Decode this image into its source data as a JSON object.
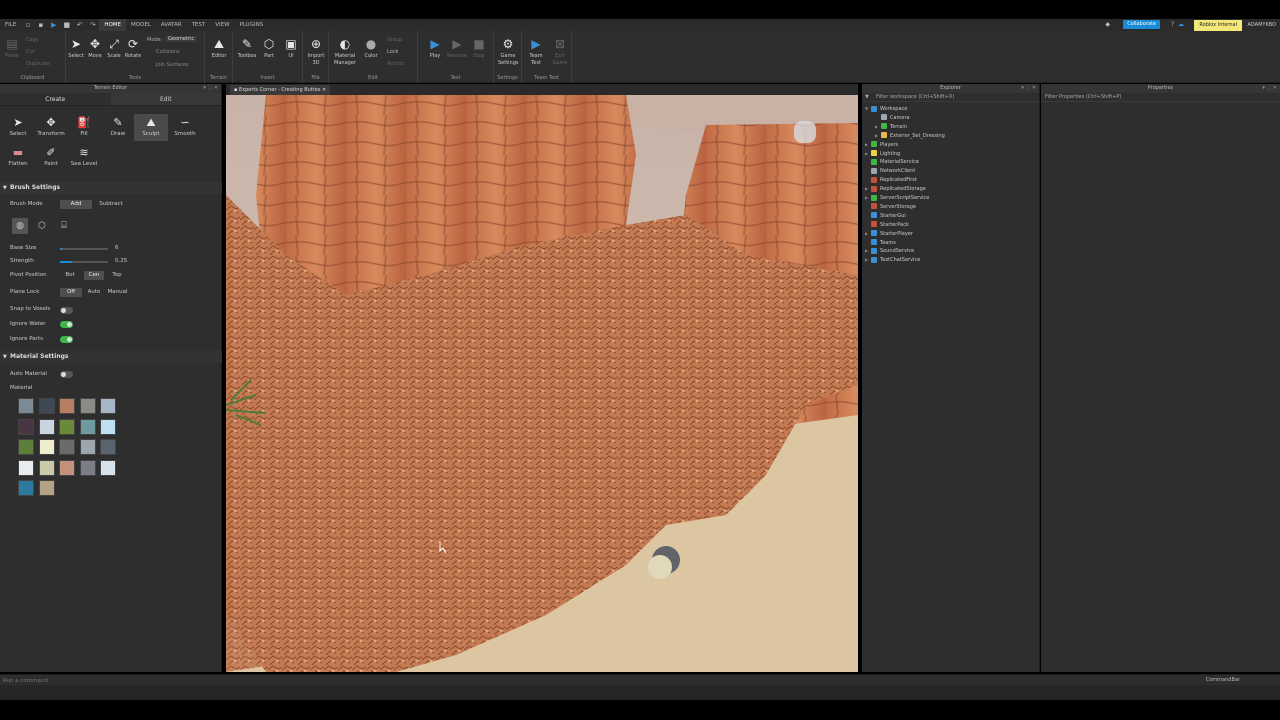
{
  "menu": {
    "file": "FILE",
    "tabs": [
      "HOME",
      "MODEL",
      "AVATAR",
      "TEST",
      "VIEW",
      "PLUGINS"
    ],
    "collaborate": "Collaborate",
    "internal": "Roblox Internal",
    "user": "ADAMYKBO"
  },
  "ribbon": {
    "clipboard": {
      "label": "Clipboard",
      "paste": "Paste",
      "copy": "Copy",
      "cut": "Cut",
      "duplicate": "Duplicate"
    },
    "tools": {
      "label": "Tools",
      "select": "Select",
      "move": "Move",
      "scale": "Scale",
      "rotate": "Rotate",
      "mode_label": "Mode:",
      "mode_value": "Geometric",
      "collisions": "Collisions",
      "join": "Join Surfaces"
    },
    "terrain": {
      "label": "Terrain",
      "editor": "Editor"
    },
    "insert": {
      "label": "Insert",
      "toolbox": "Toolbox",
      "part": "Part",
      "ui": "UI"
    },
    "file": {
      "label": "File",
      "import": "Import 3D"
    },
    "edit": {
      "label": "Edit",
      "material": "Material Manager",
      "color": "Color",
      "group": "Group",
      "lock": "Lock",
      "anchor": "Anchor"
    },
    "test": {
      "label": "Test",
      "play": "Play",
      "resume": "Resume",
      "stop": "Stop"
    },
    "settings": {
      "label": "Settings",
      "game": "Game Settings"
    },
    "team": {
      "label": "Team Test",
      "teamtest": "Team Test",
      "exit": "Exit Game"
    }
  },
  "terrain_editor": {
    "title": "Terrain Editor",
    "tab_create": "Create",
    "tab_edit": "Edit",
    "tools": [
      "Select",
      "Transform",
      "Fill",
      "Draw",
      "Sculpt",
      "Smooth",
      "Flatten",
      "Paint",
      "Sea Level"
    ],
    "brush_settings": "Brush Settings",
    "brush_mode": "Brush Mode",
    "add": "Add",
    "subtract": "Subtract",
    "base_size": "Base Size",
    "base_size_value": "6",
    "base_size_frac": 0.05,
    "strength": "Strength",
    "strength_value": "0.25",
    "strength_frac": 0.25,
    "pivot": "Pivot Position",
    "pivot_opts": [
      "Bot",
      "Cen",
      "Top"
    ],
    "plane_lock": "Plane Lock",
    "plane_opts": [
      "Off",
      "Auto",
      "Manual"
    ],
    "snap": "Snap to Voxels",
    "ignore_water": "Ignore Water",
    "ignore_parts": "Ignore Parts",
    "material_settings": "Material Settings",
    "auto_material": "Auto Material",
    "material": "Material",
    "swatches": [
      "#7c8a96",
      "#3f4855",
      "#b67f64",
      "#8a8a86",
      "#a6b6c7",
      "#4a3544",
      "#c9d4e0",
      "#6a8a3a",
      "#6e9aa0",
      "#bfe0f2",
      "#5d7f3a",
      "#eeeccf",
      "#6b6b6b",
      "#9ea7ae",
      "#596470",
      "#e9ecef",
      "#c8c9a6",
      "#c4927a",
      "#7a7e86",
      "#d6e2ec",
      "#2a7b9e",
      "#b3a488"
    ]
  },
  "viewport": {
    "tab": "Experts Corner - Creating Buttes"
  },
  "explorer": {
    "title": "Explorer",
    "filter": "Filter workspace (Ctrl+Shift+X)",
    "items": [
      {
        "label": "Workspace",
        "indent": 0,
        "color": "#3b8fd6",
        "open": true
      },
      {
        "label": "Camera",
        "indent": 1,
        "color": "#9aa7b4"
      },
      {
        "label": "Terrain",
        "indent": 1,
        "color": "#3fb54a",
        "arrow": true
      },
      {
        "label": "Exterior_Set_Dressing",
        "indent": 1,
        "color": "#e8b84a",
        "arrow": true
      },
      {
        "label": "Players",
        "indent": 0,
        "color": "#3fb54a",
        "arrow": true
      },
      {
        "label": "Lighting",
        "indent": 0,
        "color": "#f0d24a",
        "arrow": true
      },
      {
        "label": "MaterialService",
        "indent": 0,
        "color": "#3fb54a"
      },
      {
        "label": "NetworkClient",
        "indent": 0,
        "color": "#9aa7b4"
      },
      {
        "label": "ReplicatedFirst",
        "indent": 0,
        "color": "#c4503f"
      },
      {
        "label": "ReplicatedStorage",
        "indent": 0,
        "color": "#c4503f",
        "arrow": true
      },
      {
        "label": "ServerScriptService",
        "indent": 0,
        "color": "#3fb54a",
        "arrow": true
      },
      {
        "label": "ServerStorage",
        "indent": 0,
        "color": "#c4503f"
      },
      {
        "label": "StarterGui",
        "indent": 0,
        "color": "#3b8fd6"
      },
      {
        "label": "StarterPack",
        "indent": 0,
        "color": "#c4503f"
      },
      {
        "label": "StarterPlayer",
        "indent": 0,
        "color": "#3b8fd6",
        "arrow": true
      },
      {
        "label": "Teams",
        "indent": 0,
        "color": "#3b8fd6"
      },
      {
        "label": "SoundService",
        "indent": 0,
        "color": "#3b8fd6",
        "arrow": true
      },
      {
        "label": "TextChatService",
        "indent": 0,
        "color": "#3b8fd6",
        "arrow": true
      }
    ]
  },
  "properties": {
    "title": "Properties",
    "filter": "Filter Properties (Ctrl+Shift+P)"
  },
  "command": {
    "placeholder": "Run a command",
    "label": "CommandBar"
  }
}
